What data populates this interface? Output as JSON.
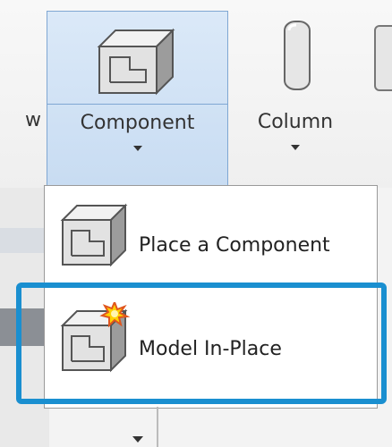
{
  "ribbon": {
    "cut_label": "w",
    "component_label": "Component",
    "column_label": "Column"
  },
  "menu": {
    "items": [
      {
        "label": "Place a Component"
      },
      {
        "label": "Model In-Place"
      }
    ]
  },
  "colors": {
    "highlight": "#1a8fd0",
    "selected_button_bg": "#cfe1f5"
  },
  "icons": {
    "component": "component-icon",
    "column": "column-icon",
    "model_in_place": "model-in-place-icon"
  }
}
